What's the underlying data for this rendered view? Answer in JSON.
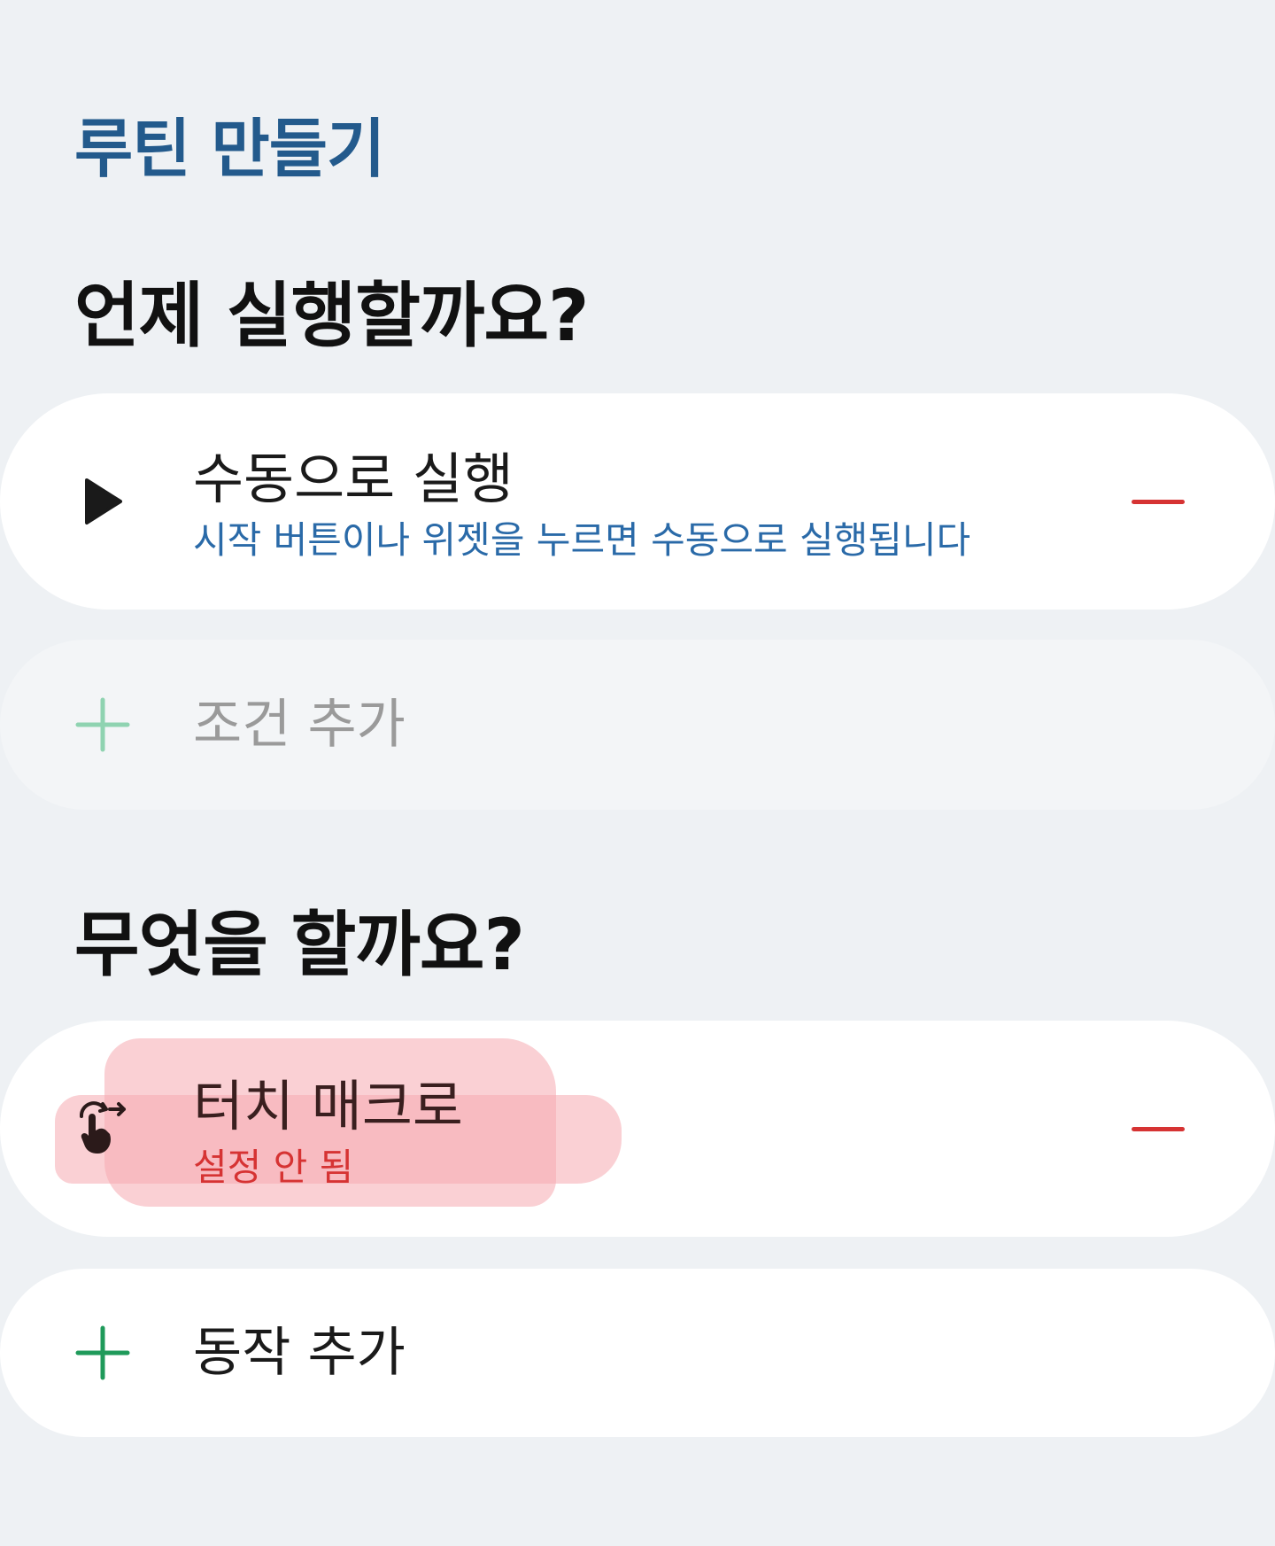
{
  "header": {
    "title": "루틴 만들기"
  },
  "when_section": {
    "heading": "언제 실행할까요?",
    "trigger": {
      "icon": "play-icon",
      "title": "수동으로 실행",
      "subtitle": "시작 버튼이나 위젯을 누르면 수동으로 실행됩니다"
    },
    "add_condition": {
      "icon": "plus-icon",
      "label": "조건 추가"
    }
  },
  "what_section": {
    "heading": "무엇을 할까요?",
    "action": {
      "icon": "touch-gesture-icon",
      "title": "터치 매크로",
      "subtitle": "설정 안 됨"
    },
    "add_action": {
      "icon": "plus-icon",
      "label": "동작 추가"
    }
  },
  "colors": {
    "background": "#eef1f4",
    "title_blue": "#235a8c",
    "subtitle_blue": "#2a6aa8",
    "danger_red": "#d63333",
    "add_green": "#1f9a5a",
    "add_green_muted": "#8fd3b1",
    "highlight_pink": "#f7c9cd"
  }
}
